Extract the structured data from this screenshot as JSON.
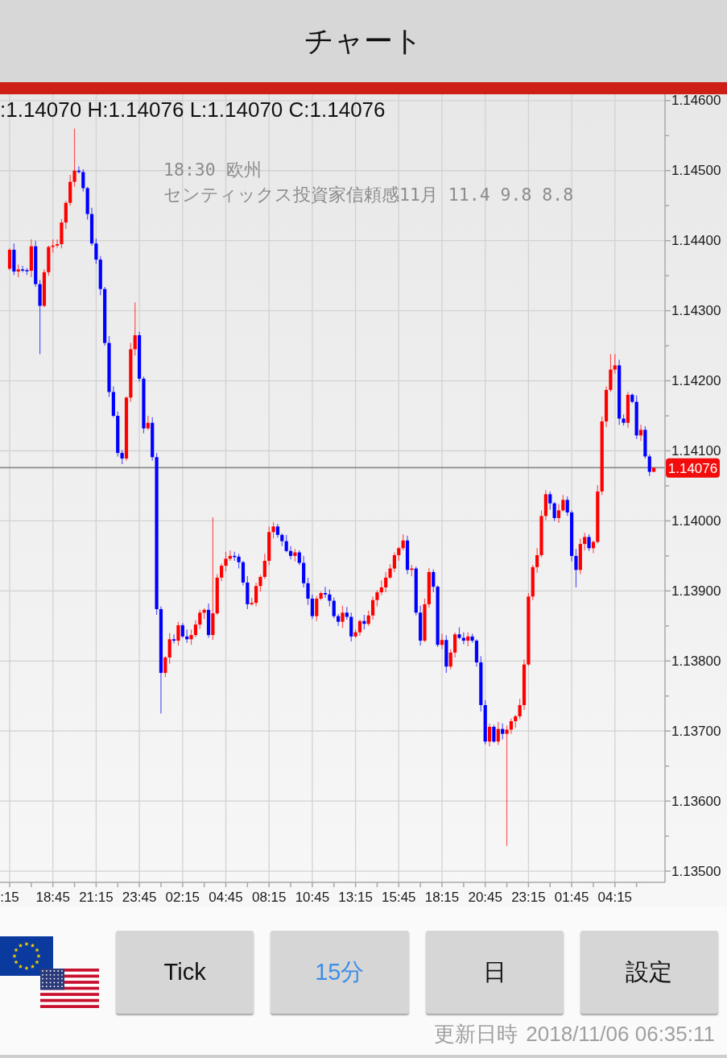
{
  "header": {
    "title": "チャート"
  },
  "chart": {
    "ohlc_readout": ":1.14070 H:1.14076 L:1.14070 C:1.14076",
    "event": {
      "time_region": "18:30 欧州",
      "description": "センティックス投資家信頼感11月 11.4 9.8 8.8"
    },
    "chart_data": {
      "type": "candlestick",
      "categories": [
        ":15",
        null,
        null,
        null,
        null,
        null,
        null,
        null,
        null,
        null,
        "18:45",
        null,
        null,
        null,
        null,
        null,
        null,
        null,
        null,
        null,
        "21:15",
        null,
        null,
        null,
        null,
        null,
        null,
        null,
        null,
        null,
        "23:45",
        null,
        null,
        null,
        null,
        null,
        null,
        null,
        null,
        null,
        "02:15",
        null,
        null,
        null,
        null,
        null,
        null,
        null,
        null,
        null,
        "04:45",
        null,
        null,
        null,
        null,
        null,
        null,
        null,
        null,
        null,
        "08:15",
        null,
        null,
        null,
        null,
        null,
        null,
        null,
        null,
        null,
        "10:45",
        null,
        null,
        null,
        null,
        null,
        null,
        null,
        null,
        null,
        "13:15",
        null,
        null,
        null,
        null,
        null,
        null,
        null,
        null,
        null,
        "15:45",
        null,
        null,
        null,
        null,
        null,
        null,
        null,
        null,
        null,
        "18:15",
        null,
        null,
        null,
        null,
        null,
        null,
        null,
        null,
        null,
        "20:45",
        null,
        null,
        null,
        null,
        null,
        null,
        null,
        null,
        null,
        "23:15",
        null,
        null,
        null,
        null,
        null,
        null,
        null,
        null,
        null,
        "01:45",
        null,
        null,
        null,
        null,
        null,
        null,
        null,
        null,
        null,
        "04:15",
        null,
        null,
        null,
        null,
        null,
        null,
        null,
        null,
        null
      ],
      "ohlc": [
        [
          1.1436,
          1.14389,
          1.14358,
          1.14387
        ],
        [
          1.14387,
          1.14396,
          1.14351,
          1.14356
        ],
        [
          1.14356,
          1.14366,
          1.14348,
          1.14359
        ],
        [
          1.14359,
          1.14364,
          1.14355,
          1.14358
        ],
        [
          1.14358,
          1.14361,
          1.14351,
          1.14357
        ],
        [
          1.14357,
          1.14402,
          1.14348,
          1.14392
        ],
        [
          1.14392,
          1.144,
          1.14334,
          1.14338
        ],
        [
          1.14338,
          1.14344,
          1.14238,
          1.14307
        ],
        [
          1.14307,
          1.14359,
          1.14305,
          1.14355
        ],
        [
          1.14355,
          1.14393,
          1.1435,
          1.14391
        ],
        [
          1.14391,
          1.14402,
          1.14383,
          1.14393
        ],
        [
          1.14393,
          1.14402,
          1.1439,
          1.14395
        ],
        [
          1.14395,
          1.14431,
          1.14389,
          1.14426
        ],
        [
          1.14426,
          1.14457,
          1.14417,
          1.14454
        ],
        [
          1.14454,
          1.14494,
          1.1445,
          1.14484
        ],
        [
          1.14484,
          1.1456,
          1.14477,
          1.145
        ],
        [
          1.145,
          1.14506,
          1.14496,
          1.14498
        ],
        [
          1.14498,
          1.14502,
          1.1447,
          1.14475
        ],
        [
          1.14475,
          1.14477,
          1.1443,
          1.14438
        ],
        [
          1.14438,
          1.14447,
          1.14393,
          1.14396
        ],
        [
          1.14396,
          1.14403,
          1.14367,
          1.14373
        ],
        [
          1.14373,
          1.14378,
          1.14322,
          1.14331
        ],
        [
          1.14331,
          1.14334,
          1.1425,
          1.14254
        ],
        [
          1.14254,
          1.14264,
          1.14177,
          1.14184
        ],
        [
          1.14184,
          1.14192,
          1.14148,
          1.1415
        ],
        [
          1.1415,
          1.14156,
          1.14092,
          1.14097
        ],
        [
          1.14097,
          1.14101,
          1.14081,
          1.14089
        ],
        [
          1.14089,
          1.14178,
          1.14086,
          1.14176
        ],
        [
          1.14176,
          1.14254,
          1.1417,
          1.14245
        ],
        [
          1.14245,
          1.14312,
          1.14236,
          1.14265
        ],
        [
          1.14265,
          1.1427,
          1.14199,
          1.14203
        ],
        [
          1.14203,
          1.14206,
          1.14125,
          1.14132
        ],
        [
          1.14132,
          1.1415,
          1.1413,
          1.1414
        ],
        [
          1.1414,
          1.14148,
          1.14086,
          1.14091
        ],
        [
          1.14091,
          1.14097,
          1.13866,
          1.13874
        ],
        [
          1.13874,
          1.13878,
          1.13725,
          1.13783
        ],
        [
          1.13783,
          1.13807,
          1.13777,
          1.13805
        ],
        [
          1.13805,
          1.1384,
          1.13796,
          1.13831
        ],
        [
          1.13831,
          1.13838,
          1.13825,
          1.13829
        ],
        [
          1.13829,
          1.13856,
          1.13822,
          1.13851
        ],
        [
          1.13851,
          1.13854,
          1.13833,
          1.13835
        ],
        [
          1.13835,
          1.13845,
          1.13826,
          1.13831
        ],
        [
          1.13831,
          1.13845,
          1.13823,
          1.13837
        ],
        [
          1.13837,
          1.13858,
          1.13834,
          1.13852
        ],
        [
          1.13852,
          1.13873,
          1.13846,
          1.13869
        ],
        [
          1.13869,
          1.13875,
          1.1386,
          1.13873
        ],
        [
          1.13873,
          1.13882,
          1.13833,
          1.13837
        ],
        [
          1.13837,
          1.14005,
          1.1383,
          1.13868
        ],
        [
          1.13868,
          1.13924,
          1.13866,
          1.13919
        ],
        [
          1.13919,
          1.13939,
          1.13914,
          1.13936
        ],
        [
          1.13936,
          1.13956,
          1.13928,
          1.13946
        ],
        [
          1.13946,
          1.13958,
          1.13943,
          1.1395
        ],
        [
          1.1395,
          1.13956,
          1.13943,
          1.13949
        ],
        [
          1.13949,
          1.13953,
          1.13932,
          1.13941
        ],
        [
          1.13941,
          1.13943,
          1.13908,
          1.13912
        ],
        [
          1.13912,
          1.13921,
          1.13874,
          1.13881
        ],
        [
          1.13881,
          1.1389,
          1.13879,
          1.13883
        ],
        [
          1.13883,
          1.13912,
          1.13878,
          1.13907
        ],
        [
          1.13907,
          1.13923,
          1.13899,
          1.1392
        ],
        [
          1.1392,
          1.13953,
          1.13917,
          1.13943
        ],
        [
          1.13943,
          1.13992,
          1.13937,
          1.13984
        ],
        [
          1.13984,
          1.13998,
          1.13975,
          1.13992
        ],
        [
          1.13992,
          1.13996,
          1.13976,
          1.1398
        ],
        [
          1.1398,
          1.13982,
          1.13964,
          1.13971
        ],
        [
          1.13971,
          1.1398,
          1.13955,
          1.13957
        ],
        [
          1.13957,
          1.13964,
          1.13945,
          1.1395
        ],
        [
          1.1395,
          1.1396,
          1.13942,
          1.13955
        ],
        [
          1.13955,
          1.13958,
          1.13937,
          1.1394
        ],
        [
          1.1394,
          1.1395,
          1.13905,
          1.13911
        ],
        [
          1.13911,
          1.13919,
          1.1388,
          1.13889
        ],
        [
          1.13889,
          1.13895,
          1.1386,
          1.13864
        ],
        [
          1.13864,
          1.13893,
          1.13857,
          1.13889
        ],
        [
          1.13889,
          1.13899,
          1.13887,
          1.13897
        ],
        [
          1.13897,
          1.13906,
          1.1389,
          1.13895
        ],
        [
          1.13895,
          1.13902,
          1.13878,
          1.13886
        ],
        [
          1.13886,
          1.13891,
          1.13861,
          1.13864
        ],
        [
          1.13864,
          1.13867,
          1.1385,
          1.13856
        ],
        [
          1.13856,
          1.13879,
          1.13847,
          1.13869
        ],
        [
          1.13869,
          1.13877,
          1.13859,
          1.13863
        ],
        [
          1.13863,
          1.13869,
          1.13828,
          1.13835
        ],
        [
          1.13835,
          1.13845,
          1.13833,
          1.13841
        ],
        [
          1.13841,
          1.13859,
          1.13836,
          1.13857
        ],
        [
          1.13857,
          1.13866,
          1.13845,
          1.13853
        ],
        [
          1.13853,
          1.13872,
          1.1385,
          1.13865
        ],
        [
          1.13865,
          1.13892,
          1.13859,
          1.13887
        ],
        [
          1.13887,
          1.13901,
          1.13878,
          1.13898
        ],
        [
          1.13898,
          1.13915,
          1.13894,
          1.13905
        ],
        [
          1.13905,
          1.13927,
          1.13898,
          1.13919
        ],
        [
          1.13919,
          1.13938,
          1.13917,
          1.13932
        ],
        [
          1.13932,
          1.13955,
          1.13927,
          1.13951
        ],
        [
          1.13951,
          1.13963,
          1.13943,
          1.13961
        ],
        [
          1.13961,
          1.13981,
          1.13958,
          1.13972
        ],
        [
          1.13972,
          1.13979,
          1.13924,
          1.1393
        ],
        [
          1.1393,
          1.13937,
          1.13921,
          1.13932
        ],
        [
          1.13932,
          1.13935,
          1.13865,
          1.13869
        ],
        [
          1.13869,
          1.13879,
          1.13822,
          1.13829
        ],
        [
          1.13829,
          1.13889,
          1.13827,
          1.13881
        ],
        [
          1.13881,
          1.13933,
          1.13876,
          1.13927
        ],
        [
          1.13927,
          1.13931,
          1.13898,
          1.13906
        ],
        [
          1.13906,
          1.13908,
          1.1382,
          1.13823
        ],
        [
          1.13823,
          1.13839,
          1.13817,
          1.1383
        ],
        [
          1.1383,
          1.13837,
          1.13783,
          1.13792
        ],
        [
          1.13792,
          1.13817,
          1.13788,
          1.13812
        ],
        [
          1.13812,
          1.13841,
          1.13805,
          1.13838
        ],
        [
          1.13838,
          1.13848,
          1.13831,
          1.13833
        ],
        [
          1.13833,
          1.13841,
          1.13824,
          1.13829
        ],
        [
          1.13829,
          1.13841,
          1.13821,
          1.13835
        ],
        [
          1.13835,
          1.13839,
          1.13826,
          1.13829
        ],
        [
          1.13829,
          1.13831,
          1.13792,
          1.13798
        ],
        [
          1.13798,
          1.13807,
          1.13728,
          1.13737
        ],
        [
          1.13737,
          1.13744,
          1.13681,
          1.13685
        ],
        [
          1.13685,
          1.13711,
          1.13678,
          1.13706
        ],
        [
          1.13706,
          1.13709,
          1.13683,
          1.13685
        ],
        [
          1.13685,
          1.13713,
          1.1368,
          1.13703
        ],
        [
          1.13703,
          1.13711,
          1.13688,
          1.13696
        ],
        [
          1.13696,
          1.13708,
          1.13536,
          1.13702
        ],
        [
          1.13702,
          1.13718,
          1.13696,
          1.13714
        ],
        [
          1.13714,
          1.13723,
          1.13705,
          1.13721
        ],
        [
          1.13721,
          1.13746,
          1.13717,
          1.13737
        ],
        [
          1.13737,
          1.13802,
          1.1373,
          1.13795
        ],
        [
          1.13795,
          1.13897,
          1.13793,
          1.13892
        ],
        [
          1.13892,
          1.13937,
          1.13887,
          1.13934
        ],
        [
          1.13934,
          1.13961,
          1.13926,
          1.13951
        ],
        [
          1.13951,
          1.14015,
          1.13948,
          1.14007
        ],
        [
          1.14007,
          1.14044,
          1.14001,
          1.14038
        ],
        [
          1.14038,
          1.14042,
          1.14016,
          1.14025
        ],
        [
          1.14025,
          1.14027,
          1.14,
          1.14004
        ],
        [
          1.14004,
          1.14024,
          1.13997,
          1.14015
        ],
        [
          1.14015,
          1.14037,
          1.14013,
          1.1403
        ],
        [
          1.1403,
          1.14035,
          1.14007,
          1.14012
        ],
        [
          1.14012,
          1.14015,
          1.13942,
          1.1395
        ],
        [
          1.1395,
          1.1396,
          1.13905,
          1.1393
        ],
        [
          1.1393,
          1.13975,
          1.13924,
          1.13967
        ],
        [
          1.13967,
          1.13983,
          1.13958,
          1.13977
        ],
        [
          1.13977,
          1.13981,
          1.13957,
          1.13961
        ],
        [
          1.13961,
          1.13972,
          1.13954,
          1.1397
        ],
        [
          1.1397,
          1.14051,
          1.13968,
          1.14042
        ],
        [
          1.14042,
          1.14149,
          1.14037,
          1.14142
        ],
        [
          1.14142,
          1.14192,
          1.14134,
          1.14187
        ],
        [
          1.14187,
          1.14238,
          1.14184,
          1.14216
        ],
        [
          1.14216,
          1.14238,
          1.1421,
          1.14222
        ],
        [
          1.14222,
          1.1423,
          1.14137,
          1.14146
        ],
        [
          1.14146,
          1.14152,
          1.14136,
          1.1414
        ],
        [
          1.1414,
          1.14184,
          1.14133,
          1.1418
        ],
        [
          1.1418,
          1.14182,
          1.14168,
          1.1417
        ],
        [
          1.1417,
          1.14179,
          1.14117,
          1.14122
        ],
        [
          1.14122,
          1.14137,
          1.14114,
          1.1413
        ],
        [
          1.1413,
          1.14135,
          1.14089,
          1.14092
        ],
        [
          1.14092,
          1.14095,
          1.14064,
          1.1407
        ],
        [
          1.1407,
          1.14076,
          1.1407,
          1.14076
        ]
      ],
      "ylim": [
        1.13484,
        1.14609
      ],
      "grid": true,
      "ref_lines": [
        {
          "axis": "y",
          "value": 1.14076,
          "label": "1.14076"
        }
      ],
      "yticks": [
        {
          "value": 1.146,
          "label": "1.14600"
        },
        {
          "value": 1.145,
          "label": "1.14500"
        },
        {
          "value": 1.144,
          "label": "1.14400"
        },
        {
          "value": 1.143,
          "label": "1.14300"
        },
        {
          "value": 1.142,
          "label": "1.14200"
        },
        {
          "value": 1.141,
          "label": "1.14100"
        },
        {
          "value": 1.14,
          "label": "1.14000"
        },
        {
          "value": 1.139,
          "label": "1.13900"
        },
        {
          "value": 1.138,
          "label": "1.13800"
        },
        {
          "value": 1.137,
          "label": "1.13700"
        },
        {
          "value": 1.136,
          "label": "1.13600"
        },
        {
          "value": 1.135,
          "label": "1.13500"
        }
      ]
    }
  },
  "timeframe_buttons": [
    {
      "label": "Tick",
      "selected": false
    },
    {
      "label": "15分",
      "selected": true
    },
    {
      "label": "日",
      "selected": false
    }
  ],
  "settings_button": {
    "label": "設定"
  },
  "last_updated": {
    "label": "更新日時",
    "value": "2018/11/06 06:35:11"
  }
}
